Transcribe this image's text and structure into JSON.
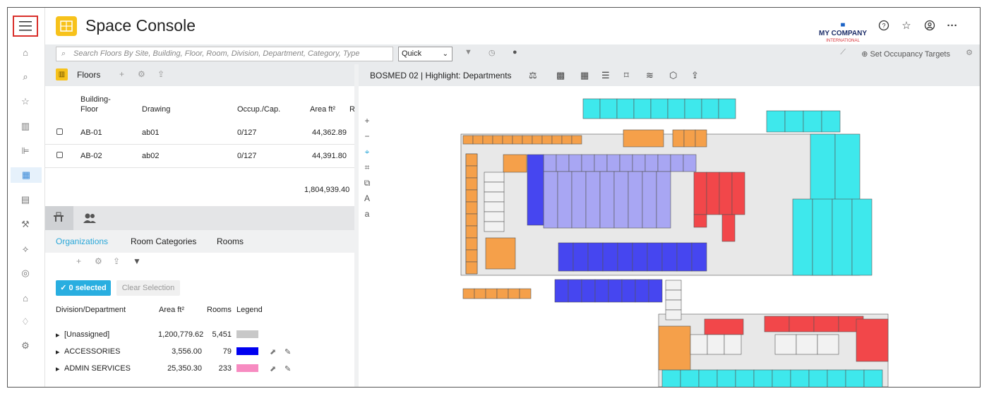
{
  "app": {
    "title": "Space Console",
    "brand_name": "MY COMPANY",
    "brand_sub": "INTERNATIONAL"
  },
  "rail": {
    "items": [
      {
        "name": "home-icon",
        "glyph": "⌂"
      },
      {
        "name": "search-icon",
        "glyph": "⌕"
      },
      {
        "name": "star-icon",
        "glyph": "☆"
      },
      {
        "name": "buildings-icon",
        "glyph": "▥"
      },
      {
        "name": "chart-icon",
        "glyph": "⊫"
      },
      {
        "name": "floorplan-icon",
        "glyph": "▦"
      },
      {
        "name": "report-icon",
        "glyph": "▤"
      },
      {
        "name": "wrench-icon",
        "glyph": "⚒"
      },
      {
        "name": "leaf-icon",
        "glyph": "⟡"
      },
      {
        "name": "move-icon",
        "glyph": "◎"
      },
      {
        "name": "building-icon",
        "glyph": "⌂"
      },
      {
        "name": "lightbulb-icon",
        "glyph": "♢"
      },
      {
        "name": "settings-icon",
        "glyph": "⚙"
      }
    ]
  },
  "toolbar": {
    "search_placeholder": "Search Floors By Site, Building, Floor, Room, Division, Department, Category, Type",
    "quick_value": "Quick",
    "occupancy_label": "Set Occupancy Targets"
  },
  "floors": {
    "label": "Floors",
    "columns": [
      "Building-\nFloor",
      "Drawing",
      "Occup./Cap.",
      "Area ft²",
      "R"
    ],
    "rows": [
      {
        "floor": "AB-01",
        "drawing": "ab01",
        "occ": "0/127",
        "area": "44,362.89"
      },
      {
        "floor": "AB-02",
        "drawing": "ab02",
        "occ": "0/127",
        "area": "44,391.80"
      }
    ],
    "total": "1,804,939.40"
  },
  "orgs": {
    "tabs": [
      "Organizations",
      "Room Categories",
      "Rooms"
    ],
    "selected_label": "✓ 0 selected",
    "clear_label": "Clear Selection",
    "columns": [
      "Division/Department",
      "Area ft²",
      "Rooms",
      "Legend"
    ],
    "rows": [
      {
        "name": "[Unassigned]",
        "area": "1,200,779.62",
        "rooms": "5,451",
        "color": "#c8c8c8",
        "editable": false
      },
      {
        "name": "ACCESSORIES",
        "area": "3,556.00",
        "rooms": "79",
        "color": "#0000f0",
        "editable": true
      },
      {
        "name": "ADMIN SERVICES",
        "area": "25,350.30",
        "rooms": "233",
        "color": "#f78bc1",
        "editable": true
      }
    ]
  },
  "map": {
    "title": "BOSMED 02 | Highlight: Departments",
    "colors": {
      "cyan": "#3ee8ec",
      "orange": "#f5a04a",
      "lavender": "#a8a6f3",
      "blue": "#4646f0",
      "red": "#f2474a",
      "gray": "#e8e8e8"
    }
  }
}
